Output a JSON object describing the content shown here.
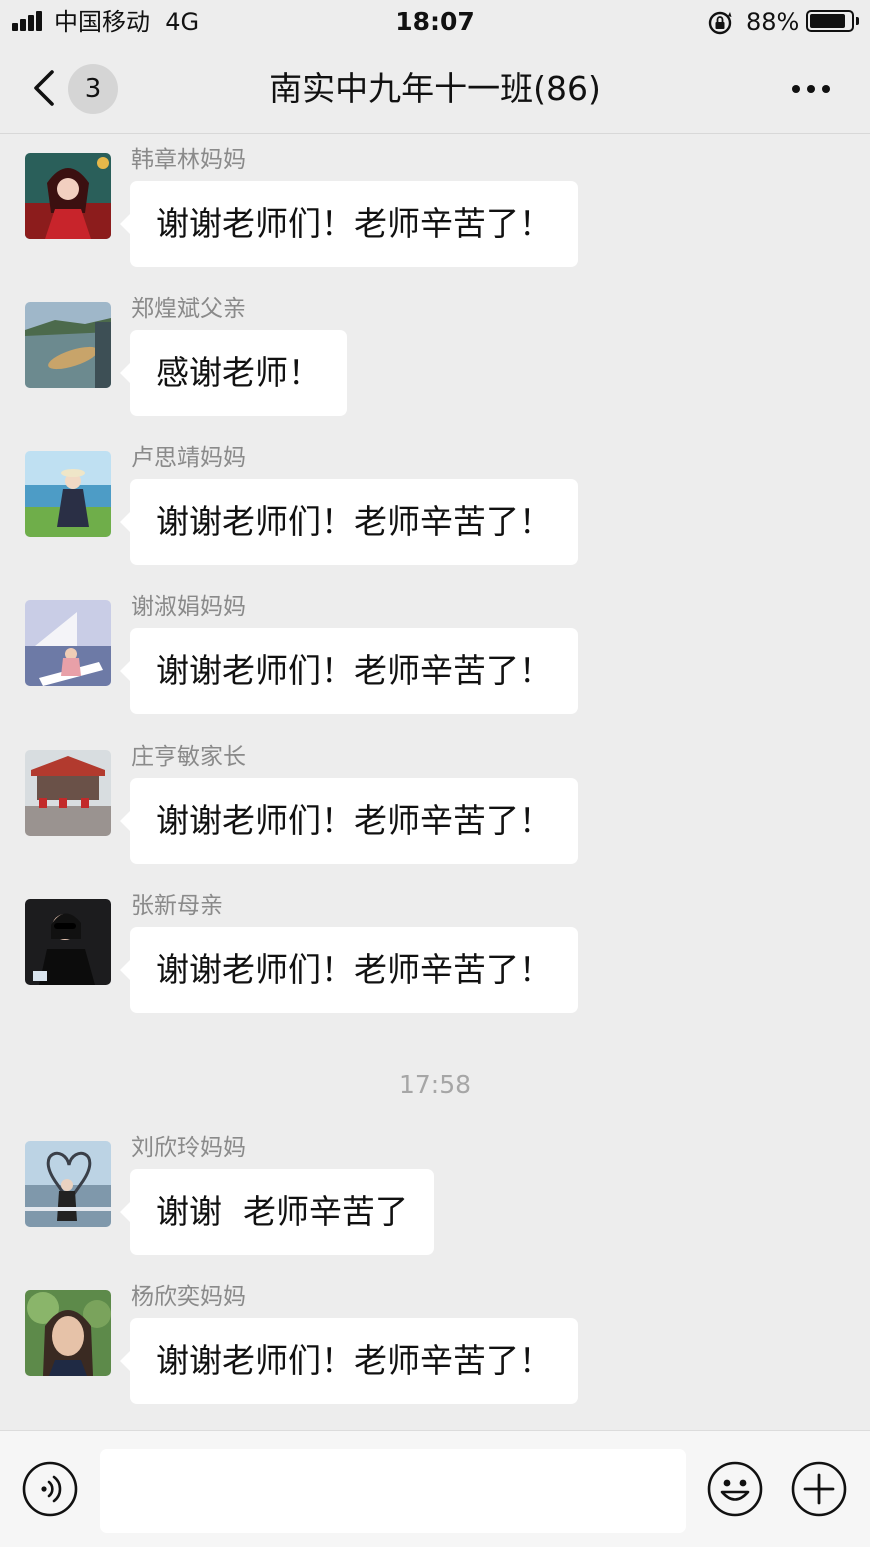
{
  "status_bar": {
    "carrier": "中国移动",
    "network": "4G",
    "time": "18:07",
    "battery": "88%",
    "battery_level": 0.88
  },
  "header": {
    "unread_count": "3",
    "title": "南实中九年十一班(86)"
  },
  "messages_before": [
    {
      "sender": "韩章林妈妈",
      "text": "谢谢老师们！老师辛苦了！"
    },
    {
      "sender": "郑煌斌父亲",
      "text": "感谢老师！"
    },
    {
      "sender": "卢思靖妈妈",
      "text": "谢谢老师们！老师辛苦了！"
    },
    {
      "sender": "谢淑娟妈妈",
      "text": "谢谢老师们！老师辛苦了！"
    },
    {
      "sender": "庄亨敏家长",
      "text": "谢谢老师们！老师辛苦了！"
    },
    {
      "sender": "张新母亲",
      "text": "谢谢老师们！老师辛苦了！"
    }
  ],
  "timestamp": "17:58",
  "messages_after": [
    {
      "sender": "刘欣玲妈妈",
      "text": "谢谢  老师辛苦了"
    },
    {
      "sender": "杨欣奕妈妈",
      "text": "谢谢老师们！老师辛苦了！"
    }
  ],
  "input": {
    "value": ""
  },
  "colors": {
    "background": "#ededed",
    "bubble": "#ffffff",
    "sender_text": "#8a8a8a",
    "timestamp_text": "#a6a6a6"
  },
  "icons": [
    "signal-icon",
    "lock-rotation-icon",
    "battery-icon",
    "back-chevron-icon",
    "more-icon",
    "voice-icon",
    "emoji-icon",
    "plus-icon"
  ]
}
